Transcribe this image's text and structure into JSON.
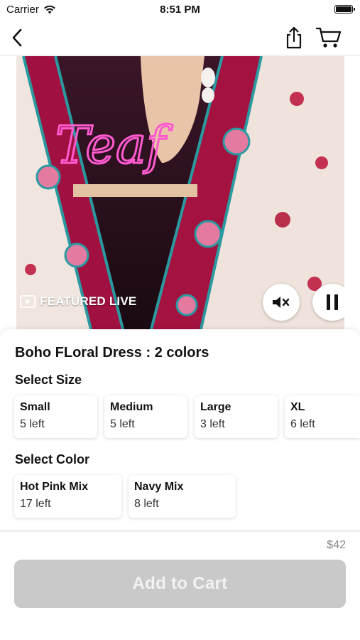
{
  "status_bar": {
    "carrier": "Carrier",
    "time": "8:51 PM"
  },
  "nav": {
    "back_icon": "chevron-left-icon",
    "share_icon": "share-icon",
    "cart_icon": "cart-icon"
  },
  "video": {
    "badge_label": "FEATURED LIVE",
    "neon_text": "Teaf",
    "mute_icon": "speaker-mute-icon",
    "pause_icon": "pause-icon"
  },
  "product": {
    "title": "Boho FLoral Dress : 2 colors",
    "size_section_title": "Select Size",
    "sizes": [
      {
        "name": "Small",
        "left": "5 left"
      },
      {
        "name": "Medium",
        "left": "5 left"
      },
      {
        "name": "Large",
        "left": "3 left"
      },
      {
        "name": "XL",
        "left": "6 left"
      }
    ],
    "color_section_title": "Select Color",
    "colors": [
      {
        "name": "Hot Pink Mix",
        "left": "17 left"
      },
      {
        "name": "Navy Mix",
        "left": "8 left"
      }
    ],
    "price": "$42",
    "add_to_cart_label": "Add to Cart"
  },
  "colors": {
    "accent_disabled": "#c9c9c9",
    "fabric_red": "#a01040",
    "trim_teal": "#2a9aa0",
    "neon_pink": "#ff5ad0"
  }
}
